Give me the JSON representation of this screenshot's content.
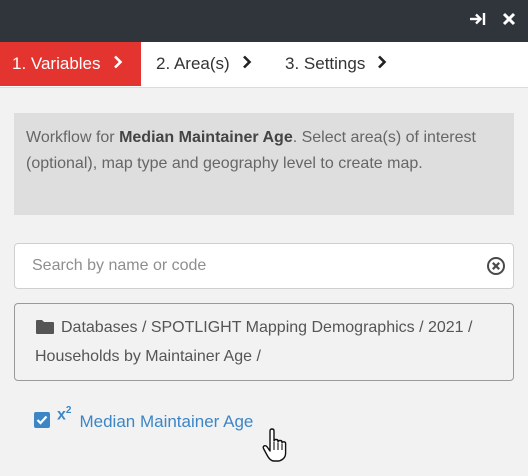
{
  "topbar": {
    "icons": [
      "export-icon",
      "close-icon"
    ]
  },
  "tabs": [
    {
      "label": "1. Variables",
      "active": true
    },
    {
      "label": "2. Area(s)",
      "active": false
    },
    {
      "label": "3. Settings",
      "active": false
    }
  ],
  "info": {
    "prefix": "Workflow for ",
    "variable": "Median Maintainer Age",
    "suffix": ". Select area(s) of interest (optional), map type and geography level to create map."
  },
  "search": {
    "placeholder": "Search by name or code",
    "value": ""
  },
  "breadcrumb": {
    "text": "Databases / SPOTLIGHT Mapping Demographics / 2021 / Households by Maintainer Age /"
  },
  "variable_item": {
    "checked": true,
    "type_badge": "x",
    "type_badge_sup": "2",
    "label": "Median Maintainer Age"
  },
  "colors": {
    "topbar": "#2f353b",
    "active_tab": "#e3342f",
    "link": "#3d86c6"
  }
}
